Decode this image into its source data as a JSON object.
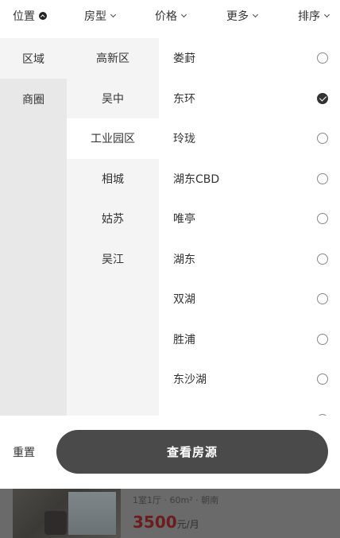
{
  "filter_bar": {
    "tabs": [
      {
        "label": "位置",
        "active": true
      },
      {
        "label": "房型",
        "active": false
      },
      {
        "label": "价格",
        "active": false
      },
      {
        "label": "更多",
        "active": false
      },
      {
        "label": "排序",
        "active": false
      }
    ]
  },
  "location_panel": {
    "level1": [
      {
        "label": "区域",
        "active": true
      },
      {
        "label": "商圈",
        "active": false
      }
    ],
    "level2": [
      {
        "label": "高新区",
        "active": false
      },
      {
        "label": "吴中",
        "active": false
      },
      {
        "label": "工业园区",
        "active": true
      },
      {
        "label": "相城",
        "active": false
      },
      {
        "label": "姑苏",
        "active": false
      },
      {
        "label": "吴江",
        "active": false
      }
    ],
    "level3": [
      {
        "label": "娄葑",
        "checked": false
      },
      {
        "label": "东环",
        "checked": true
      },
      {
        "label": "玲珑",
        "checked": false
      },
      {
        "label": "湖东CBD",
        "checked": false
      },
      {
        "label": "唯亭",
        "checked": false
      },
      {
        "label": "湖东",
        "checked": false
      },
      {
        "label": "双湖",
        "checked": false
      },
      {
        "label": "胜浦",
        "checked": false
      },
      {
        "label": "东沙湖",
        "checked": false
      },
      {
        "label": "",
        "checked": false
      }
    ]
  },
  "actions": {
    "reset_label": "重置",
    "submit_label": "查看房源"
  },
  "listing_preview": {
    "meta": "1室1厅 · 60m² · 朝南",
    "price": "3500",
    "price_unit": "元/月"
  },
  "colors": {
    "submit_bg": "#4a4a4a",
    "level1_bg": "#e8e8e8",
    "level2_bg": "#f4f4f4",
    "price_color": "#6b1c1c"
  }
}
